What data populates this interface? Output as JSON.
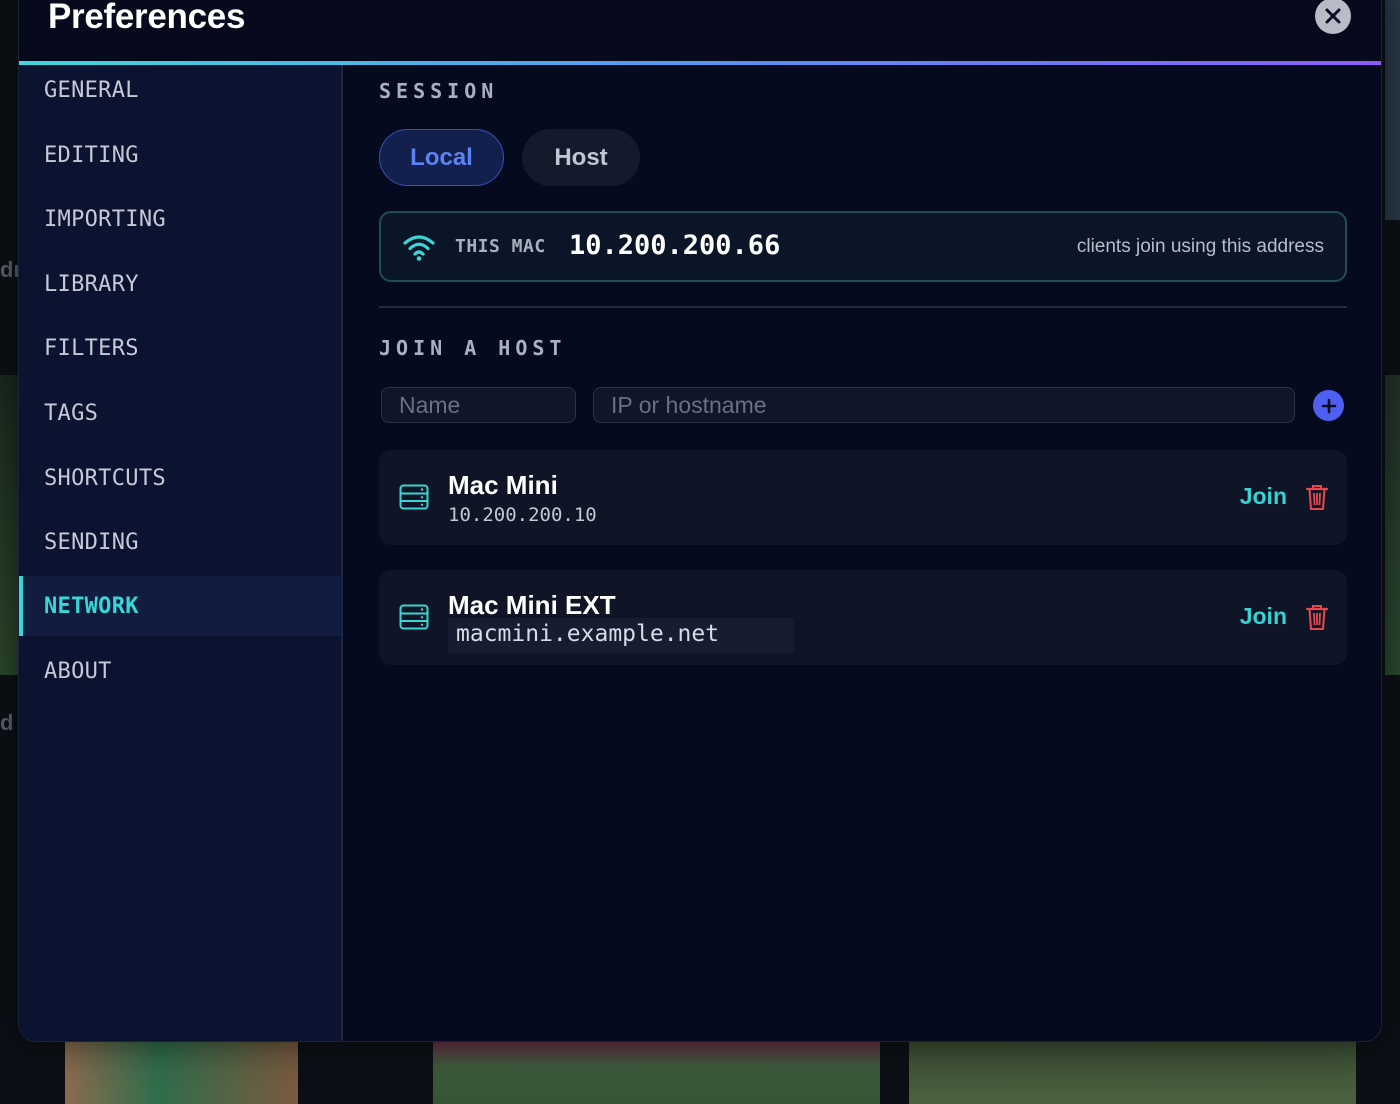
{
  "modal": {
    "title": "Preferences"
  },
  "sidebar": {
    "items": [
      {
        "label": "GENERAL",
        "active": false
      },
      {
        "label": "EDITING",
        "active": false
      },
      {
        "label": "IMPORTING",
        "active": false
      },
      {
        "label": "LIBRARY",
        "active": false
      },
      {
        "label": "FILTERS",
        "active": false
      },
      {
        "label": "TAGS",
        "active": false
      },
      {
        "label": "SHORTCUTS",
        "active": false
      },
      {
        "label": "SENDING",
        "active": false
      },
      {
        "label": "NETWORK",
        "active": true
      },
      {
        "label": "ABOUT",
        "active": false
      }
    ]
  },
  "session": {
    "label": "SESSION",
    "modes": [
      "Local",
      "Host"
    ],
    "selected": "Local"
  },
  "this_mac": {
    "label": "THIS MAC",
    "ip": "10.200.200.66",
    "hint": "clients join using this address"
  },
  "join": {
    "label": "JOIN A HOST",
    "name_placeholder": "Name",
    "host_placeholder": "IP or hostname"
  },
  "hosts": [
    {
      "name": "Mac Mini",
      "address": "10.200.200.10",
      "join_label": "Join"
    },
    {
      "name": "Mac Mini EXT",
      "address": "macmini.example.net",
      "join_label": "Join"
    }
  ],
  "colors": {
    "accent": "#3ad6d6",
    "primary": "#4f5ff2",
    "danger": "#e5484d",
    "modal_bg": "#050a1e",
    "sidebar_bg": "#0b1330"
  },
  "background": {
    "left_labels": [
      "dr",
      "d"
    ]
  }
}
